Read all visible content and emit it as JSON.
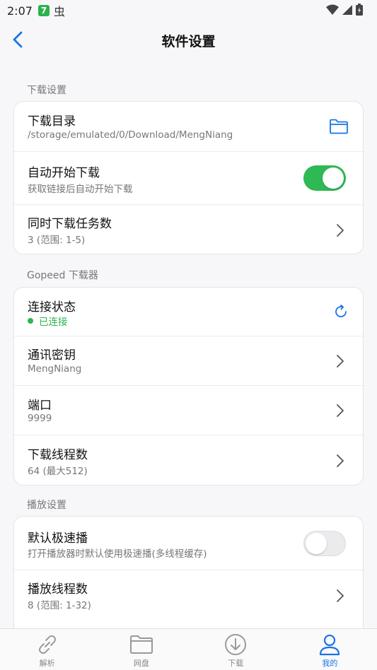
{
  "status_bar": {
    "time": "2:07",
    "app1_glyph": "7",
    "app2_glyph": "虫"
  },
  "header": {
    "title": "软件设置"
  },
  "sections": [
    {
      "label": "下载设置",
      "rows": [
        {
          "title": "下载目录",
          "subtitle": "/storage/emulated/0/Download/MengNiang",
          "action": "folder-icon"
        },
        {
          "title": "自动开始下载",
          "subtitle": "获取链接后自动开始下载",
          "action": "toggle",
          "toggle_on": true
        },
        {
          "title": "同时下载任务数",
          "subtitle": "3 (范围: 1-5)",
          "action": "chevron-right-icon"
        }
      ]
    },
    {
      "label": "Gopeed 下载器",
      "rows": [
        {
          "title": "连接状态",
          "subtitle": "已连接",
          "action": "refresh-icon"
        },
        {
          "title": "通讯密钥",
          "subtitle": "MengNiang",
          "action": "chevron-right-icon"
        },
        {
          "title": "端口",
          "subtitle": "9999",
          "action": "chevron-right-icon"
        },
        {
          "title": "下载线程数",
          "subtitle": "64 (最大512)",
          "action": "chevron-right-icon"
        }
      ]
    },
    {
      "label": "播放设置",
      "rows": [
        {
          "title": "默认极速播",
          "subtitle": "打开播放器时默认使用极速播(多线程缓存)",
          "action": "toggle",
          "toggle_on": false
        },
        {
          "title": "播放线程数",
          "subtitle": "8 (范围: 1-32)",
          "action": "chevron-right-icon"
        }
      ]
    }
  ],
  "tabbar": [
    {
      "label": "解析",
      "icon": "link-icon",
      "active": false
    },
    {
      "label": "网盘",
      "icon": "folder-icon",
      "active": false
    },
    {
      "label": "下载",
      "icon": "download-icon",
      "active": false
    },
    {
      "label": "我的",
      "icon": "user-icon",
      "active": true
    }
  ],
  "colors": {
    "accent": "#1a73e8",
    "toggle_on": "#2fb954",
    "connected": "#2db552"
  }
}
